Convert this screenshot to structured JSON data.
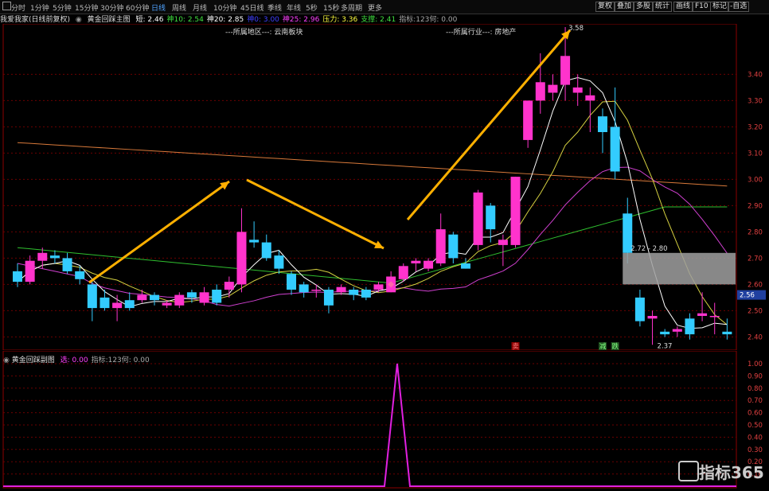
{
  "toolbar": {
    "periods": [
      "分时",
      "1分钟",
      "5分钟",
      "15分钟",
      "30分钟",
      "60分钟",
      "日线",
      "周线",
      "月线",
      "10分钟",
      "45日线",
      "季线",
      "年线",
      "5秒",
      "15秒",
      "多周期",
      "更多"
    ],
    "active_period": "日线",
    "tools": [
      "复权",
      "叠加",
      "多股",
      "统计",
      "画线",
      "F10",
      "标记",
      "-自选"
    ]
  },
  "info": {
    "stock": "我爱我家(日线前复权)",
    "indicator_name": "黄金回踩主图",
    "items": [
      {
        "label": "短:",
        "value": "2.46",
        "color": "#ffffff"
      },
      {
        "label": "神10:",
        "value": "2.54",
        "color": "#40e040"
      },
      {
        "label": "神20:",
        "value": "2.85",
        "color": "#ffffff"
      },
      {
        "label": "神0:",
        "value": "3.00",
        "color": "#4040ff"
      },
      {
        "label": "神25:",
        "value": "2.96",
        "color": "#ff40ff"
      },
      {
        "label": "压力:",
        "value": "3.36",
        "color": "#ffff40"
      },
      {
        "label": "支撑:",
        "value": "2.41",
        "color": "#40e040"
      },
      {
        "label": "指标:123何:",
        "value": "0.00",
        "color": "#aaaaaa"
      }
    ]
  },
  "regions": {
    "area": "---所属地区---: 云南板块",
    "industry": "---所属行业---: 房地产"
  },
  "annotations": {
    "peak": "3.58",
    "trough": "2.37",
    "range": "2.72 - 2.80",
    "current_price": "2.56",
    "tag_sell": "卖",
    "tag_buy1": "减",
    "tag_buy2": "跌"
  },
  "lower": {
    "name": "黄金回踩副图",
    "items": [
      {
        "label": "选:",
        "value": "0.00",
        "color": "#ff40ff"
      },
      {
        "label": "指标:123何:",
        "value": "0.00",
        "color": "#aaaaaa"
      }
    ]
  },
  "y_axis": [
    "3.40",
    "3.30",
    "3.20",
    "3.10",
    "3.00",
    "2.90",
    "2.80",
    "2.70",
    "2.60",
    "2.50",
    "2.40"
  ],
  "y_axis_low": [
    "1.00",
    "0.90",
    "0.80",
    "0.70",
    "0.60",
    "0.50",
    "0.40",
    "0.30",
    "0.20",
    "0.10"
  ],
  "logo_text": "指标365",
  "colors": {
    "up": "#ff33cc",
    "down": "#33ccff",
    "grid": "#8b0000"
  },
  "chart_data": {
    "type": "candlestick",
    "candles": [
      {
        "o": 2.65,
        "c": 2.61,
        "h": 2.68,
        "l": 2.59
      },
      {
        "o": 2.61,
        "c": 2.69,
        "h": 2.71,
        "l": 2.6
      },
      {
        "o": 2.69,
        "c": 2.72,
        "h": 2.74,
        "l": 2.66
      },
      {
        "o": 2.71,
        "c": 2.7,
        "h": 2.73,
        "l": 2.68
      },
      {
        "o": 2.7,
        "c": 2.65,
        "h": 2.72,
        "l": 2.64
      },
      {
        "o": 2.65,
        "c": 2.62,
        "h": 2.67,
        "l": 2.6
      },
      {
        "o": 2.6,
        "c": 2.51,
        "h": 2.62,
        "l": 2.46
      },
      {
        "o": 2.55,
        "c": 2.51,
        "h": 2.58,
        "l": 2.5
      },
      {
        "o": 2.51,
        "c": 2.53,
        "h": 2.56,
        "l": 2.46
      },
      {
        "o": 2.54,
        "c": 2.51,
        "h": 2.57,
        "l": 2.5
      },
      {
        "o": 2.54,
        "c": 2.56,
        "h": 2.58,
        "l": 2.53
      },
      {
        "o": 2.56,
        "c": 2.54,
        "h": 2.57,
        "l": 2.52
      },
      {
        "o": 2.52,
        "c": 2.53,
        "h": 2.54,
        "l": 2.51
      },
      {
        "o": 2.52,
        "c": 2.56,
        "h": 2.57,
        "l": 2.51
      },
      {
        "o": 2.57,
        "c": 2.55,
        "h": 2.58,
        "l": 2.53
      },
      {
        "o": 2.53,
        "c": 2.57,
        "h": 2.59,
        "l": 2.52
      },
      {
        "o": 2.58,
        "c": 2.53,
        "h": 2.6,
        "l": 2.52
      },
      {
        "o": 2.58,
        "c": 2.61,
        "h": 2.63,
        "l": 2.55
      },
      {
        "o": 2.6,
        "c": 2.8,
        "h": 2.89,
        "l": 2.57
      },
      {
        "o": 2.77,
        "c": 2.76,
        "h": 2.84,
        "l": 2.74
      },
      {
        "o": 2.76,
        "c": 2.7,
        "h": 2.79,
        "l": 2.69
      },
      {
        "o": 2.71,
        "c": 2.66,
        "h": 2.73,
        "l": 2.64
      },
      {
        "o": 2.64,
        "c": 2.58,
        "h": 2.65,
        "l": 2.56
      },
      {
        "o": 2.6,
        "c": 2.57,
        "h": 2.61,
        "l": 2.55
      },
      {
        "o": 2.58,
        "c": 2.58,
        "h": 2.6,
        "l": 2.55
      },
      {
        "o": 2.58,
        "c": 2.52,
        "h": 2.59,
        "l": 2.49
      },
      {
        "o": 2.57,
        "c": 2.59,
        "h": 2.6,
        "l": 2.56
      },
      {
        "o": 2.58,
        "c": 2.56,
        "h": 2.59,
        "l": 2.54
      },
      {
        "o": 2.58,
        "c": 2.55,
        "h": 2.59,
        "l": 2.54
      },
      {
        "o": 2.58,
        "c": 2.6,
        "h": 2.61,
        "l": 2.57
      },
      {
        "o": 2.57,
        "c": 2.63,
        "h": 2.65,
        "l": 2.57
      },
      {
        "o": 2.62,
        "c": 2.67,
        "h": 2.68,
        "l": 2.61
      },
      {
        "o": 2.68,
        "c": 2.69,
        "h": 2.7,
        "l": 2.65
      },
      {
        "o": 2.66,
        "c": 2.69,
        "h": 2.7,
        "l": 2.65
      },
      {
        "o": 2.68,
        "c": 2.81,
        "h": 2.87,
        "l": 2.67
      },
      {
        "o": 2.79,
        "c": 2.7,
        "h": 2.8,
        "l": 2.68
      },
      {
        "o": 2.68,
        "c": 2.66,
        "h": 2.7,
        "l": 2.66
      },
      {
        "o": 2.75,
        "c": 2.95,
        "h": 2.96,
        "l": 2.73
      },
      {
        "o": 2.9,
        "c": 2.81,
        "h": 2.91,
        "l": 2.76
      },
      {
        "o": 2.75,
        "c": 2.77,
        "h": 2.79,
        "l": 2.67
      },
      {
        "o": 2.75,
        "c": 3.01,
        "h": 3.01,
        "l": 2.74
      },
      {
        "o": 3.15,
        "c": 3.3,
        "h": 3.3,
        "l": 3.12
      },
      {
        "o": 3.3,
        "c": 3.37,
        "h": 3.48,
        "l": 3.25
      },
      {
        "o": 3.33,
        "c": 3.36,
        "h": 3.4,
        "l": 3.3
      },
      {
        "o": 3.36,
        "c": 3.47,
        "h": 3.58,
        "l": 3.3
      },
      {
        "o": 3.33,
        "c": 3.35,
        "h": 3.4,
        "l": 3.28
      },
      {
        "o": 3.3,
        "c": 3.32,
        "h": 3.35,
        "l": 3.18
      },
      {
        "o": 3.24,
        "c": 3.18,
        "h": 3.27,
        "l": 3.1
      },
      {
        "o": 3.2,
        "c": 3.03,
        "h": 3.35,
        "l": 3.0
      },
      {
        "o": 2.87,
        "c": 2.72,
        "h": 2.93,
        "l": 2.68
      },
      {
        "o": 2.55,
        "c": 2.46,
        "h": 2.58,
        "l": 2.44
      },
      {
        "o": 2.47,
        "c": 2.48,
        "h": 2.5,
        "l": 2.37
      },
      {
        "o": 2.42,
        "c": 2.41,
        "h": 2.43,
        "l": 2.4
      },
      {
        "o": 2.42,
        "c": 2.43,
        "h": 2.44,
        "l": 2.4
      },
      {
        "o": 2.47,
        "c": 2.41,
        "h": 2.49,
        "l": 2.39
      },
      {
        "o": 2.48,
        "c": 2.49,
        "h": 2.57,
        "l": 2.46
      },
      {
        "o": 2.48,
        "c": 2.48,
        "h": 2.53,
        "l": 2.41
      },
      {
        "o": 2.42,
        "c": 2.41,
        "h": 2.47,
        "l": 2.39
      }
    ],
    "oscillator": {
      "peak_index": 30,
      "peak_value": 1.0,
      "base_value": 0.0
    }
  }
}
